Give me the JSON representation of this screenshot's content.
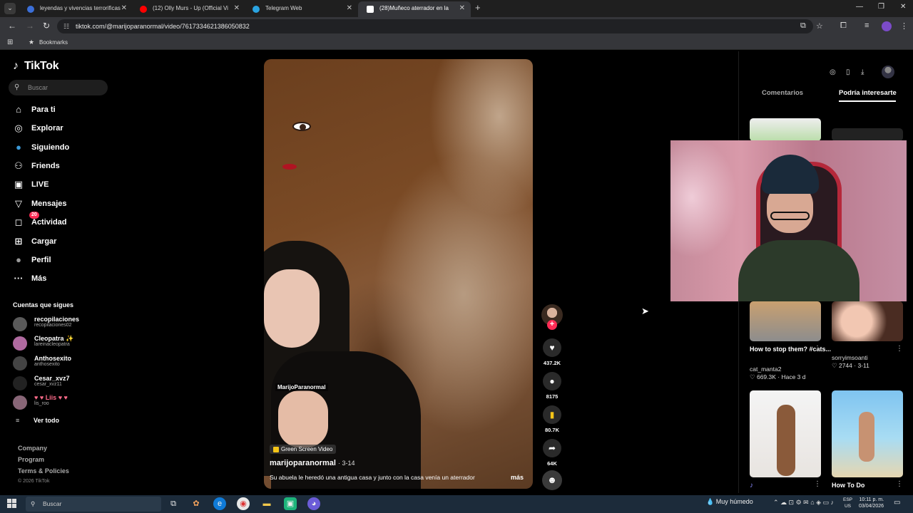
{
  "browser": {
    "tabs": [
      {
        "title": "leyendas y vivencias terrorificas",
        "fav": "#3b6fd8",
        "active": false
      },
      {
        "title": "(12) Olly Murs - Up (Official Vi",
        "fav": "#ff0000",
        "active": false
      },
      {
        "title": "Telegram Web",
        "fav": "#2aa3e0",
        "active": false
      },
      {
        "title": "(28)Muñeco aterrador en la",
        "fav": "#ffffff",
        "active": true
      }
    ],
    "url": "tiktok.com/@marijoparanormal/video/7617334621386050832",
    "bookmarks_label": "Bookmarks"
  },
  "sidebar": {
    "logo": "TikTok",
    "search_placeholder": "Buscar",
    "nav": [
      {
        "label": "Para ti",
        "icon": "home-icon",
        "glyph": "⌂"
      },
      {
        "label": "Explorar",
        "icon": "compass-icon",
        "glyph": "◎"
      },
      {
        "label": "Siguiendo",
        "icon": "following-icon",
        "glyph": "●"
      },
      {
        "label": "Friends",
        "icon": "friends-icon",
        "glyph": "⚇"
      },
      {
        "label": "LIVE",
        "icon": "live-icon",
        "glyph": "▣"
      },
      {
        "label": "Mensajes",
        "icon": "messages-icon",
        "glyph": "▽"
      },
      {
        "label": "Actividad",
        "icon": "activity-icon",
        "glyph": "◻"
      },
      {
        "label": "Cargar",
        "icon": "upload-icon",
        "glyph": "⊞"
      },
      {
        "label": "Perfil",
        "icon": "profile-icon",
        "glyph": "●"
      },
      {
        "label": "Más",
        "icon": "more-icon",
        "glyph": "···"
      }
    ],
    "activity_badge": "20",
    "following_title": "Cuentas que sigues",
    "following": [
      {
        "name": "recopilaciones",
        "handle": "recopilaciones02",
        "color": "#5a5a5a"
      },
      {
        "name": "Cleopatra ✨",
        "handle": "lareinacleopatra",
        "color": "#b06aa0"
      },
      {
        "name": "Anthosexito",
        "handle": "anthosexito",
        "color": "#444"
      },
      {
        "name": "Cesar_xvz7",
        "handle": "cesar_xvz11",
        "color": "#222"
      },
      {
        "name": "♥ ♥ Liis ♥ ♥",
        "handle": "lis_roo",
        "color": "#886677"
      }
    ],
    "see_all": "Ver todo",
    "footer": [
      "Company",
      "Program",
      "Terms & Policies"
    ],
    "copyright": "© 2026 TikTok"
  },
  "video": {
    "watermark": "MarijoParanormal",
    "effect": "Green Screen Video",
    "author": "marijoparanormal",
    "date": "· 3-14",
    "caption": "Su abuela le heredó una antigua casa y junto con la casa venía un aterrador",
    "more": "más",
    "likes": "437.2K",
    "comments": "8175",
    "saves": "80.7K",
    "shares": "64K"
  },
  "right_panel": {
    "tab_comments": "Comentarios",
    "tab_recommended": "Podría interesarte",
    "items": [
      {
        "title": "How to stop them? #cats...",
        "author": "cat_manta2",
        "stats": "♡ 669.3K · Hace 3 d"
      },
      {
        "title": "",
        "author": "sorryimsoanti",
        "stats": "♡ 2744 · 3-11"
      },
      {
        "title": "",
        "author": "",
        "stats": ""
      },
      {
        "title": "How To Do",
        "author": "",
        "stats": ""
      }
    ]
  },
  "taskbar": {
    "search_placeholder": "Buscar",
    "weather": "Muy húmedo",
    "lang_top": "ESP",
    "lang_bottom": "US",
    "time": "10:11 p. m.",
    "date": "03/04/2026"
  }
}
